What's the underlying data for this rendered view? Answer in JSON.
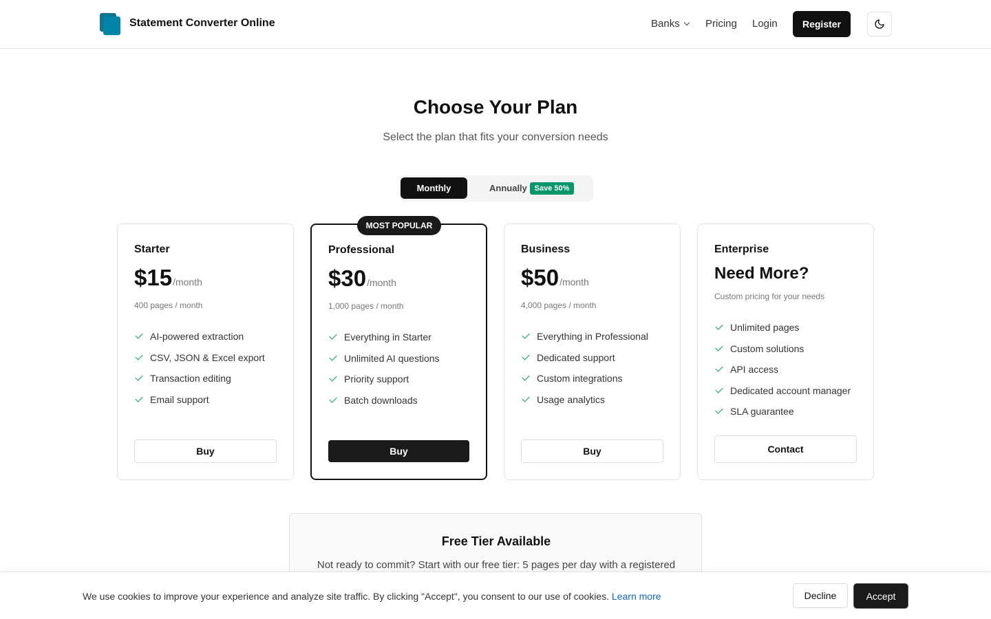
{
  "header": {
    "brand": "Statement Converter Online",
    "nav": {
      "banks": "Banks",
      "pricing": "Pricing",
      "login": "Login"
    },
    "register_label": "Register"
  },
  "hero": {
    "title": "Choose Your Plan",
    "subtitle": "Select the plan that fits your conversion needs"
  },
  "billing_toggle": {
    "monthly": "Monthly",
    "annually": "Annually",
    "save_badge": "Save 50%",
    "selected": "Monthly"
  },
  "popular_badge": "MOST POPULAR",
  "plans": [
    {
      "name": "Starter",
      "price": "$15",
      "period": "/month",
      "pages": "400 pages / month",
      "features": [
        "AI-powered extraction",
        "CSV, JSON & Excel export",
        "Transaction editing",
        "Email support"
      ],
      "button": "Buy"
    },
    {
      "name": "Professional",
      "price": "$30",
      "period": "/month",
      "pages": "1,000 pages / month",
      "features": [
        "Everything in Starter",
        "Unlimited AI questions",
        "Priority support",
        "Batch downloads"
      ],
      "button": "Buy"
    },
    {
      "name": "Business",
      "price": "$50",
      "period": "/month",
      "pages": "4,000 pages / month",
      "features": [
        "Everything in Professional",
        "Dedicated support",
        "Custom integrations",
        "Usage analytics"
      ],
      "button": "Buy"
    },
    {
      "name": "Enterprise",
      "headline": "Need More?",
      "pages": "Custom pricing for your needs",
      "features": [
        "Unlimited pages",
        "Custom solutions",
        "API access",
        "Dedicated account manager",
        "SLA guarantee"
      ],
      "button": "Contact"
    }
  ],
  "free_tier": {
    "title": "Free Tier Available",
    "text": "Not ready to commit? Start with our free tier: 5 pages per day with a registered"
  },
  "cookie_banner": {
    "text": "We use cookies to improve your experience and analyze site traffic. By clicking \"Accept\", you consent to our use of cookies.",
    "link": "Learn more",
    "decline": "Decline",
    "accept": "Accept"
  },
  "colors": {
    "primary": "#111111",
    "logo": "#0284a8",
    "check": "#059669",
    "save_badge": "#059669",
    "link": "#0f67c2"
  },
  "icons": {
    "logo": "logo-icon",
    "banks_dropdown": "chevron-down-icon",
    "theme_toggle": "moon-icon",
    "feature_check": "check-icon"
  }
}
